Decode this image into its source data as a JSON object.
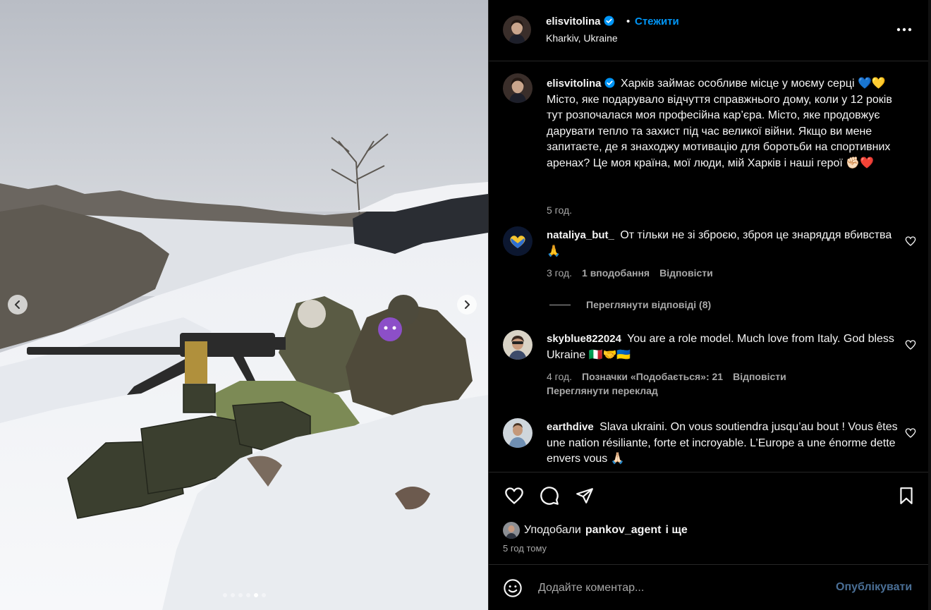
{
  "post": {
    "author": "elisvitolina",
    "follow_label": "Стежити",
    "bullet": "•",
    "location": "Kharkiv, Ukraine",
    "more_icon": "more-horizontal-icon",
    "carousel": {
      "total": 6,
      "active": 5
    }
  },
  "caption": {
    "user": "elisvitolina",
    "text": "Харків займає особливе місце у моєму серці 💙💛 Місто, яке подарувало відчуття справжнього дому, коли у 12 років тут розпочалася моя професійна кар’єра. Місто, яке продовжує дарувати тепло та захист під час великої війни. Якщо ви мене запитаєте, де я знаходжу мотивацію для боротьби на спортивних аренах? Це моя країна, мої люди, мій Харків і наші герої ✊🏻❤️",
    "time": "5 год."
  },
  "comments": [
    {
      "user": "nataliya_but_",
      "text": "От тільки не зі зброєю, зброя це знаряддя вбивства🙏",
      "time": "3 год.",
      "likes": "1 вподобання",
      "reply": "Відповісти",
      "view_replies": "Переглянути відповіді (8)"
    },
    {
      "user": "skyblue822024",
      "text": "You are a role model. Much love from Italy. God bless Ukraine 🇮🇹🤝🇺🇦",
      "time": "4 год.",
      "likes": "Позначки «Подобається»: 21",
      "reply": "Відповісти",
      "translate": "Переглянути переклад"
    },
    {
      "user": "earthdive",
      "text": "Slava ukraini. On vous soutiendra jusqu’au bout ! Vous êtes une nation résiliante, forte et incroyable. L’Europe a une énorme dette envers vous 🙏🏻"
    }
  ],
  "likes": {
    "prefix": "Уподобали",
    "user": "pankov_agent",
    "suffix": "і ще"
  },
  "time_ago": "5 год тому",
  "compose": {
    "placeholder": "Додайте коментар...",
    "post_label": "Опублікувати"
  },
  "colors": {
    "accent": "#0095f6",
    "background": "#000000",
    "muted_text": "#a8a8a8",
    "divider": "#262626"
  }
}
